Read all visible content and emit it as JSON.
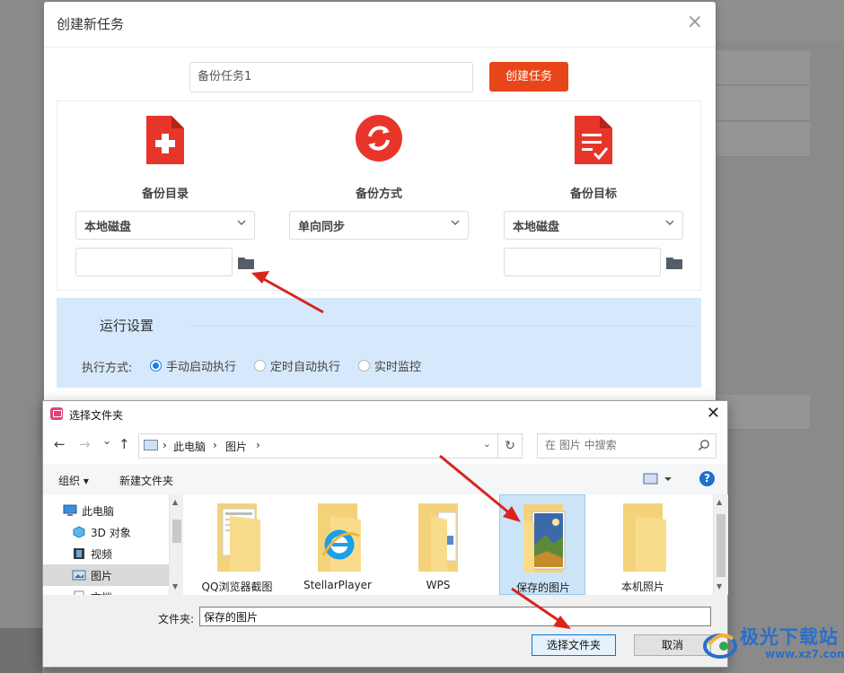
{
  "task_dialog": {
    "title": "创建新任务",
    "close_glyph": "×",
    "task_name_value": "备份任务1",
    "create_button": "创建任务",
    "columns": [
      {
        "label": "备份目录",
        "icon": "file-plus-icon",
        "select_value": "本地磁盘"
      },
      {
        "label": "备份方式",
        "icon": "sync-icon",
        "select_value": "单向同步"
      },
      {
        "label": "备份目标",
        "icon": "file-check-icon",
        "select_value": "本地磁盘"
      }
    ],
    "run_settings": {
      "title": "运行设置",
      "exec_label": "执行方式:",
      "options": [
        "手动启动执行",
        "定时自动执行",
        "实时监控"
      ],
      "selected_index": 0
    },
    "accent_color": "#e8461a"
  },
  "picker": {
    "title": "选择文件夹",
    "close_glyph": "✕",
    "nav": {
      "back": "←",
      "forward": "→",
      "up": "↑",
      "dropdown": "⌄"
    },
    "address": {
      "segments": [
        "此电脑",
        "图片"
      ],
      "separator": "›"
    },
    "refresh_glyph": "↻",
    "search_placeholder": "在 图片 中搜索",
    "toolbar": {
      "organize": "组织 ▾",
      "new_folder": "新建文件夹",
      "help": "?"
    },
    "tree": [
      {
        "label": "此电脑",
        "icon": "computer-icon"
      },
      {
        "label": "3D 对象",
        "icon": "cube-icon"
      },
      {
        "label": "视频",
        "icon": "film-icon"
      },
      {
        "label": "图片",
        "icon": "picture-icon",
        "selected": true
      },
      {
        "label": "文档",
        "icon": "document-icon"
      }
    ],
    "folders": [
      {
        "label": "QQ浏览器截图",
        "icon": "folder-screenshot-icon"
      },
      {
        "label": "StellarPlayer",
        "icon": "folder-ie-icon"
      },
      {
        "label": "WPS",
        "icon": "folder-docs-icon"
      },
      {
        "label": "保存的图片",
        "icon": "folder-photo-icon",
        "selected": true
      },
      {
        "label": "本机照片",
        "icon": "folder-icon"
      }
    ],
    "folder_field_label": "文件夹:",
    "folder_field_value": "保存的图片",
    "select_button": "选择文件夹",
    "cancel_button": "取消",
    "accent_color": "#0078d7"
  },
  "watermark": {
    "text": "极光下载站",
    "url": "www.xz7.com"
  }
}
